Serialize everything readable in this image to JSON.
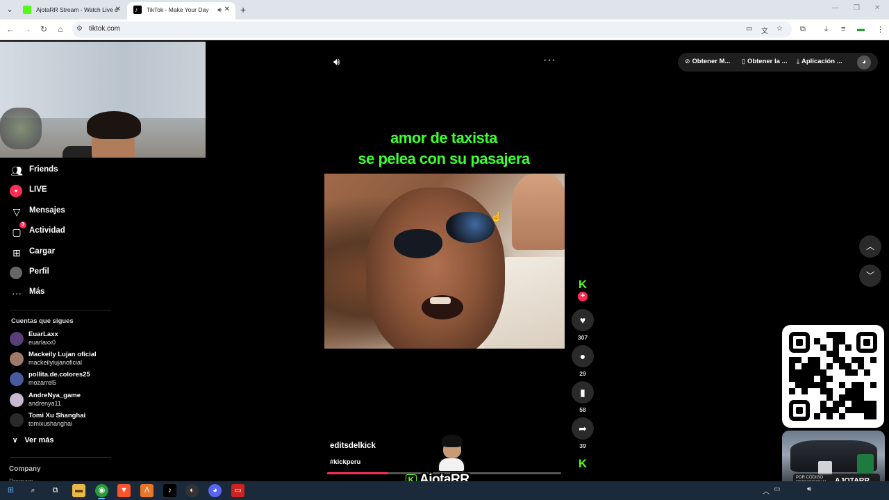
{
  "browser": {
    "tabs": [
      {
        "title": "AjotaRR Stream - Watch Live o",
        "favicon": "kick-icon"
      },
      {
        "title": "TikTok - Make Your Day",
        "favicon": "tiktok-icon"
      }
    ],
    "url": "tiktok.com"
  },
  "sidebar": {
    "items": [
      {
        "label": "Friends",
        "icon": "friends-icon"
      },
      {
        "label": "LIVE",
        "icon": "live-icon"
      },
      {
        "label": "Mensajes",
        "icon": "messages-icon"
      },
      {
        "label": "Actividad",
        "icon": "activity-icon",
        "badge": "3"
      },
      {
        "label": "Cargar",
        "icon": "upload-icon"
      },
      {
        "label": "Perfil",
        "icon": "profile-icon"
      },
      {
        "label": "Más",
        "icon": "more-icon"
      }
    ],
    "following_title": "Cuentas que sigues",
    "following": [
      {
        "name": "EuarLaxx",
        "handle": "euarlaxx0",
        "color": "#5a3e7a"
      },
      {
        "name": "Mackeily Lujan oficial",
        "handle": "mackeilylujanoficial",
        "color": "#a07a68"
      },
      {
        "name": "pollita.de.colores25",
        "handle": "mozarrel5",
        "color": "#4a5aa0"
      },
      {
        "name": "AndreNya_game",
        "handle": "andrenya11",
        "color": "#c8b8d0"
      },
      {
        "name": "Tomi Xu Shanghai",
        "handle": "tomixushanghai",
        "color": "#2a2a2a"
      }
    ],
    "see_more": "Ver más",
    "company": "Company",
    "program": "Program"
  },
  "video": {
    "caption_line1": "amor de taxista",
    "caption_line2": "se pelea con su pasajera",
    "author": "editsdelkick",
    "hashtag": "#kickperu",
    "progress": 0.26,
    "likes": "307",
    "comments": "29",
    "saves": "58",
    "shares": "39"
  },
  "topbar": {
    "item1": "Obtener M...",
    "item2": "Obtener la ...",
    "item3": "Aplicación ..."
  },
  "overlay": {
    "streamer": "AjotaRR",
    "promo_small": "POR CÓDIGO PROMOCIONAL",
    "promo_code": "AJOTARR"
  },
  "colors": {
    "accent": "#fe2c55",
    "kick_green": "#53fc18",
    "caption_green": "#3bff2e"
  }
}
